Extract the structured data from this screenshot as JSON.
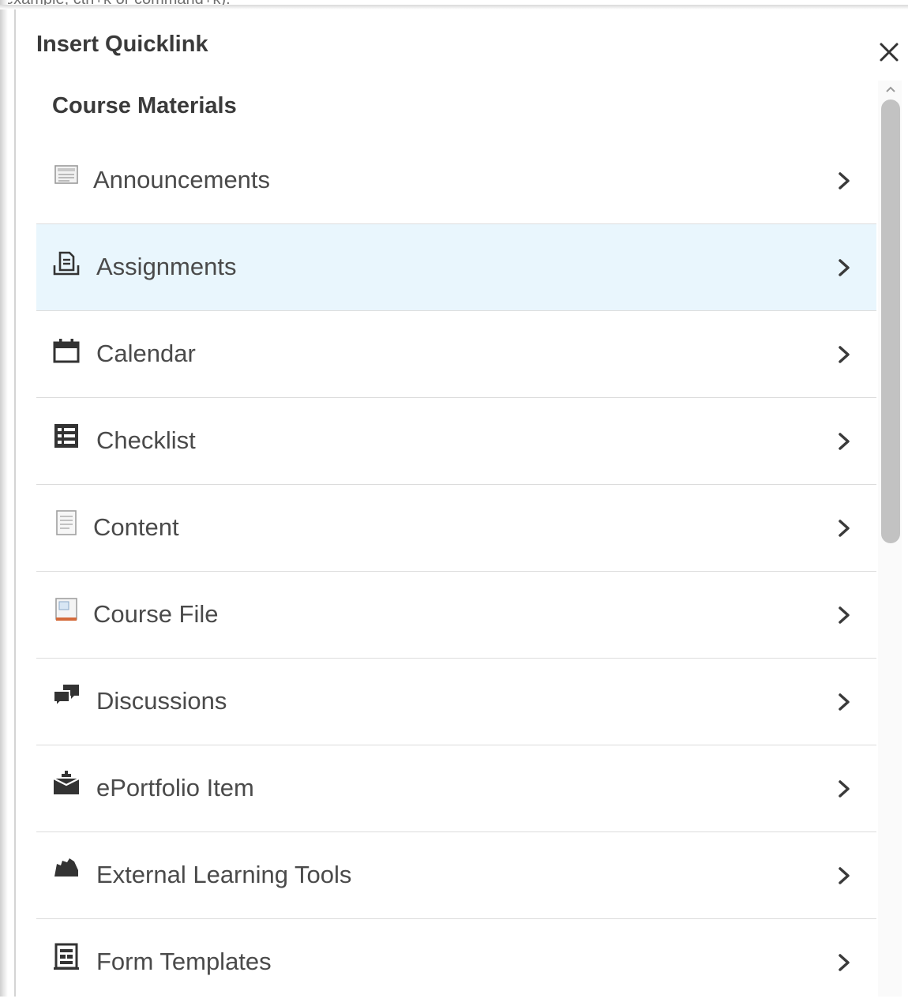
{
  "background_hint": "example, ctrl+k or command+k).",
  "dialog": {
    "title": "Insert Quicklink",
    "close_icon": "close-icon"
  },
  "section": {
    "title": "Course Materials"
  },
  "items": [
    {
      "label": "Announcements",
      "icon": "announcements-icon"
    },
    {
      "label": "Assignments",
      "icon": "assignments-icon"
    },
    {
      "label": "Calendar",
      "icon": "calendar-icon"
    },
    {
      "label": "Checklist",
      "icon": "checklist-icon"
    },
    {
      "label": "Content",
      "icon": "content-icon"
    },
    {
      "label": "Course File",
      "icon": "course-file-icon"
    },
    {
      "label": "Discussions",
      "icon": "discussions-icon"
    },
    {
      "label": "ePortfolio Item",
      "icon": "eportfolio-icon"
    },
    {
      "label": "External Learning Tools",
      "icon": "external-tools-icon"
    },
    {
      "label": "Form Templates",
      "icon": "form-templates-icon"
    }
  ],
  "highlighted_item": "Assignments",
  "colors": {
    "highlight": "#e9f6fd",
    "text": "#4a4a4a",
    "heading": "#3a3a3a",
    "divider": "#dcdcdc"
  }
}
